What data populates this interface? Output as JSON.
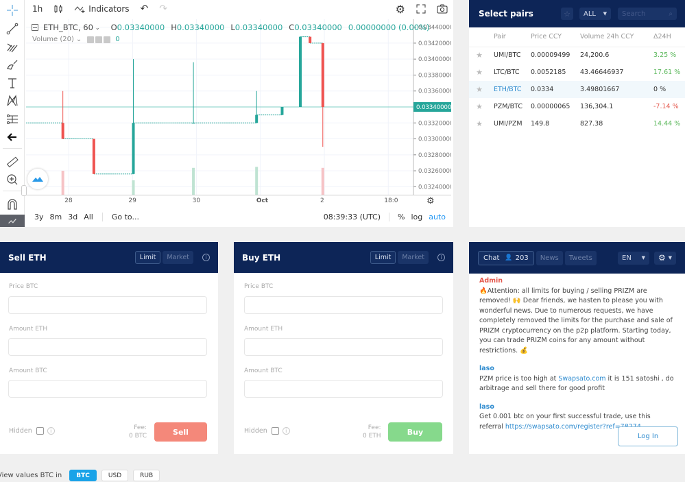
{
  "chart": {
    "toolbar": {
      "interval": "1h",
      "indicators_label": "Indicators"
    },
    "legend": {
      "symbol": "ETH_BTC, 60",
      "open_label": "O",
      "open": "0.03340000",
      "high_label": "H",
      "high": "0.03340000",
      "low_label": "L",
      "low": "0.03340000",
      "close_label": "C",
      "close": "0.03340000",
      "change": "0.00000000 (0.00%)",
      "volume_label": "Volume (20)",
      "volume_value": "0"
    },
    "price_axis": [
      "0.03440000",
      "0.03420000",
      "0.03400000",
      "0.03380000",
      "0.03360000",
      "0.03340000",
      "0.03320000",
      "0.03300000",
      "0.03280000",
      "0.03260000",
      "0.03240000"
    ],
    "current_price": "0.03340000",
    "time_axis": [
      "28",
      "29",
      "30",
      "Oct",
      "2",
      "18:0"
    ],
    "bottom": {
      "ranges": [
        "3y",
        "8m",
        "3d",
        "All"
      ],
      "goto_label": "Go to...",
      "clock": "08:39:33 (UTC)",
      "percent_label": "%",
      "log_label": "log",
      "auto_label": "auto"
    },
    "colors": {
      "up": "#26a69a",
      "down": "#ef5350"
    }
  },
  "chart_data": {
    "type": "candlestick",
    "title": "ETH_BTC, 60",
    "ylim": [
      0.0323,
      0.0345
    ],
    "x_ticks": [
      "28",
      "29",
      "30",
      "Oct",
      "2",
      "18:0"
    ],
    "candles": [
      {
        "x": 0.095,
        "open": 0.0332,
        "close": 0.033,
        "high": 0.0336,
        "low": 0.033,
        "dir": "down"
      },
      {
        "x": 0.175,
        "open": 0.033,
        "close": 0.03256,
        "high": 0.033,
        "low": 0.03256,
        "dir": "down"
      },
      {
        "x": 0.277,
        "open": 0.03256,
        "close": 0.0332,
        "high": 0.034,
        "low": 0.03256,
        "dir": "up"
      },
      {
        "x": 0.432,
        "open": 0.0332,
        "close": 0.0332,
        "high": 0.03396,
        "low": 0.0332,
        "dir": "up"
      },
      {
        "x": 0.595,
        "open": 0.0332,
        "close": 0.0333,
        "high": 0.0336,
        "low": 0.0332,
        "dir": "up"
      },
      {
        "x": 0.661,
        "open": 0.0333,
        "close": 0.0334,
        "high": 0.0334,
        "low": 0.0333,
        "dir": "up"
      },
      {
        "x": 0.708,
        "open": 0.0334,
        "close": 0.03428,
        "high": 0.03428,
        "low": 0.0334,
        "dir": "up"
      },
      {
        "x": 0.733,
        "open": 0.03428,
        "close": 0.0342,
        "high": 0.03428,
        "low": 0.0342,
        "dir": "down"
      },
      {
        "x": 0.766,
        "open": 0.0342,
        "close": 0.0334,
        "high": 0.0342,
        "low": 0.0329,
        "dir": "down"
      }
    ],
    "volume": [
      {
        "x": 0.095,
        "value": 0.5,
        "dir": "down"
      },
      {
        "x": 0.277,
        "value": 0.3,
        "dir": "up"
      },
      {
        "x": 0.432,
        "value": 0.56,
        "dir": "up"
      },
      {
        "x": 0.595,
        "value": 0.58,
        "dir": "up"
      },
      {
        "x": 0.766,
        "value": 0.56,
        "dir": "down"
      }
    ]
  },
  "pairs": {
    "title": "Select pairs",
    "filter": "ALL",
    "search_placeholder": "Search",
    "columns": [
      "Pair",
      "Price CCY",
      "Volume 24h CCY",
      "Δ24H"
    ],
    "rows": [
      {
        "pair": "UMI/BTC",
        "price": "0.00009499",
        "volume": "24,200.6",
        "change": "3.25 %",
        "trend": "up"
      },
      {
        "pair": "LTC/BTC",
        "price": "0.0052185",
        "volume": "43.46646937",
        "change": "17.61 %",
        "trend": "up"
      },
      {
        "pair": "ETH/BTC",
        "price": "0.0334",
        "volume": "3.49801667",
        "change": "0 %",
        "trend": "flat",
        "active": true
      },
      {
        "pair": "PZM/BTC",
        "price": "0.00000065",
        "volume": "136,304.1",
        "change": "-7.14 %",
        "trend": "down"
      },
      {
        "pair": "UMI/PZM",
        "price": "149.8",
        "volume": "827.38",
        "change": "14.44 %",
        "trend": "up"
      }
    ]
  },
  "sell": {
    "title": "Sell ETH",
    "limit": "Limit",
    "market": "Market",
    "price_label": "Price BTC",
    "amount_label": "Amount ETH",
    "total_label": "Amount BTC",
    "hidden_label": "Hidden",
    "fee_label": "Fee:",
    "fee_value": "0 BTC",
    "action": "Sell",
    "action_color": "#f4887a"
  },
  "buy": {
    "title": "Buy ETH",
    "limit": "Limit",
    "market": "Market",
    "price_label": "Price BTC",
    "amount_label": "Amount ETH",
    "total_label": "Amount BTC",
    "hidden_label": "Hidden",
    "fee_label": "Fee:",
    "fee_value": "0 ETH",
    "action": "Buy",
    "action_color": "#86d98c"
  },
  "chat": {
    "tabs": {
      "chat": "Chat",
      "online": "203",
      "news": "News",
      "tweets": "Tweets"
    },
    "lang": "EN",
    "messages": [
      {
        "author": "Admin",
        "text": "🔥Attention: all limits for buying / selling PRIZM are removed! 🙌 Dear friends, we hasten to please you with wonderful news. Due to numerous requests, we have completely removed the limits for the purchase and sale of PRIZM cryptocurrency on the p2p platform. Starting today, you can trade PRIZM coins for any amount without restrictions. 💰"
      },
      {
        "author": "laso",
        "pre": "PZM price is too high at ",
        "link": "Swapsato.com",
        "post": " it is 151 satoshi , do arbitrage and sell there for good profit"
      },
      {
        "author": "laso",
        "pre": "Get 0.001 btc on your first successful trade, use this referral ",
        "link": "https://swapsato.com/register?ref=78274",
        "post": ""
      }
    ],
    "login": "Log In"
  },
  "footer": {
    "label": "View values BTC in",
    "currencies": [
      "BTC",
      "USD",
      "RUB"
    ],
    "selected": "BTC"
  }
}
